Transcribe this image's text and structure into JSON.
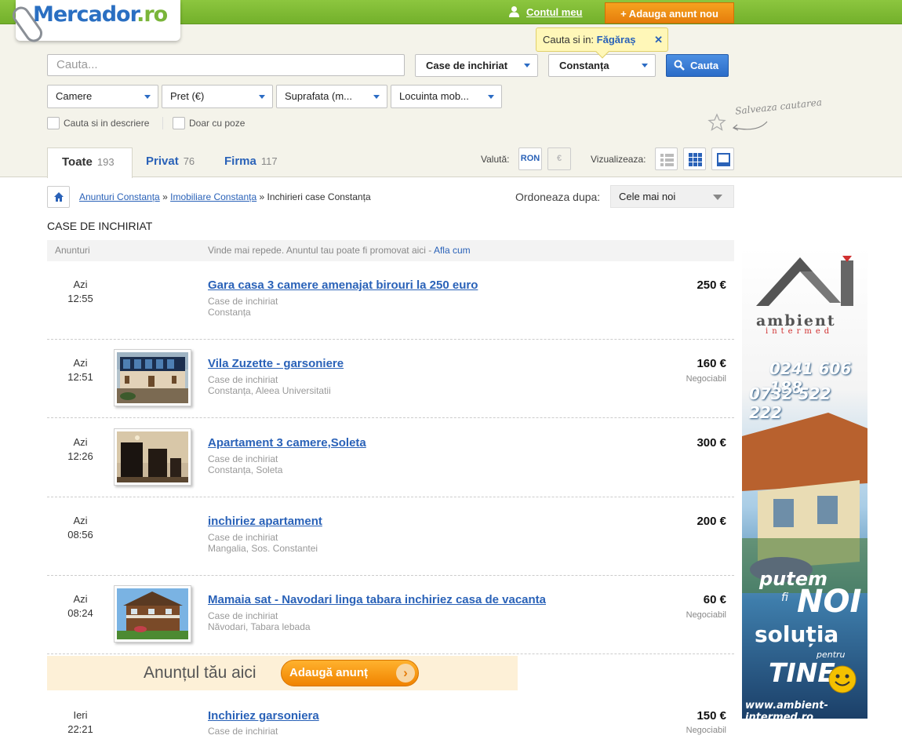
{
  "header": {
    "logo_main": "Mercador",
    "logo_tld": ".ro",
    "account_label": "Contul meu",
    "post_ad_label": "+ Adauga anunt nou"
  },
  "search": {
    "placeholder": "Cauta...",
    "category": "Case de inchiriat",
    "city": "Constanța",
    "button": "Cauta",
    "tip_prefix": "Cauta si in:",
    "tip_city": "Făgăraș",
    "tip_close": "✕"
  },
  "filters": [
    {
      "label": "Camere"
    },
    {
      "label": "Pret (€)"
    },
    {
      "label": "Suprafata (m..."
    },
    {
      "label": "Locuinta mob..."
    }
  ],
  "checkboxes": {
    "description": "Cauta si in descriere",
    "photos": "Doar cu poze"
  },
  "save_search": "Salveaza cautarea",
  "tabs": [
    {
      "label": "Toate",
      "count": "193"
    },
    {
      "label": "Privat",
      "count": "76"
    },
    {
      "label": "Firma",
      "count": "117"
    }
  ],
  "currency": {
    "label": "Valută:",
    "ron": "RON",
    "eur": "€"
  },
  "view": {
    "label": "Vizualizeaza:"
  },
  "breadcrumb": {
    "item1": "Anunturi Constanța",
    "sep": "»",
    "item2": "Imobiliare Constanța",
    "item3": "Inchirieri case Constanța"
  },
  "order": {
    "label": "Ordoneaza dupa:",
    "value": "Cele mai noi"
  },
  "section_title": "CASE DE INCHIRIAT",
  "list_header": {
    "col1": "Anunturi",
    "promo": "Vinde mai repede. Anuntul tau poate fi promovat aici -",
    "promo_link": "Afla cum"
  },
  "listings": [
    {
      "day": "Azi",
      "time": "12:55",
      "title": "Gara casa 3 camere amenajat birouri la 250 euro",
      "category": "Case de inchiriat",
      "location": "Constanța",
      "price": "250 €",
      "negotiable": ""
    },
    {
      "day": "Azi",
      "time": "12:51",
      "title": "Vila Zuzette - garsoniere",
      "category": "Case de inchiriat",
      "location": "Constanța, Aleea Universitatii",
      "price": "160 €",
      "negotiable": "Negociabil"
    },
    {
      "day": "Azi",
      "time": "12:26",
      "title": "Apartament 3 camere,Soleta",
      "category": "Case de inchiriat",
      "location": "Constanța, Soleta",
      "price": "300 €",
      "negotiable": ""
    },
    {
      "day": "Azi",
      "time": "08:56",
      "title": "inchiriez apartament",
      "category": "Case de inchiriat",
      "location": "Mangalia, Sos. Constantei",
      "price": "200 €",
      "negotiable": ""
    },
    {
      "day": "Azi",
      "time": "08:24",
      "title": "Mamaia sat - Navodari linga tabara inchiriez casa de vacanta",
      "category": "Case de inchiriat",
      "location": "Năvodari, Tabara lebada",
      "price": "60 €",
      "negotiable": "Negociabil"
    },
    {
      "day": "Ieri",
      "time": "22:21",
      "title": "Inchiriez garsoniera",
      "category": "Case de inchiriat",
      "location": "",
      "price": "150 €",
      "negotiable": "Negociabil"
    }
  ],
  "ad_banner": {
    "text": "Anunțul tău aici",
    "button": "Adaugă anunț",
    "arrow": "›"
  },
  "side_ad": {
    "brand": "ambient",
    "sub": "intermed",
    "phone1": "0241 606 188",
    "phone2": "0732 522 222",
    "line1": "putem",
    "line2": "fi",
    "line3": "NOI",
    "line4": "soluția",
    "line5": "pentru",
    "line6": "TINE",
    "website": "www.ambient-intermed.ro"
  },
  "colors": {
    "brand_green": "#7ab53a",
    "link_blue": "#2a62b8",
    "accent_orange": "#e57d0c"
  }
}
